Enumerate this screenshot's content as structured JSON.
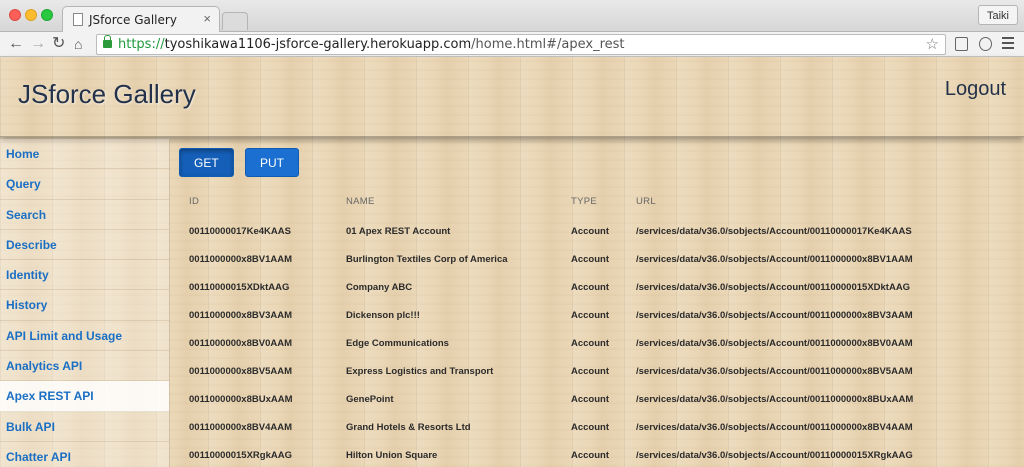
{
  "browser": {
    "tab_title": "JSforce Gallery",
    "tab_close": "×",
    "profile": "Taiki",
    "url_scheme": "https://",
    "url_host": "tyoshikawa1106-jsforce-gallery.herokuapp.com",
    "url_path": "/home.html#/apex_rest"
  },
  "header": {
    "title": "JSforce Gallery",
    "logout": "Logout"
  },
  "sidebar": {
    "items": [
      {
        "label": "Home"
      },
      {
        "label": "Query"
      },
      {
        "label": "Search"
      },
      {
        "label": "Describe"
      },
      {
        "label": "Identity"
      },
      {
        "label": "History"
      },
      {
        "label": "API Limit and Usage"
      },
      {
        "label": "Analytics API"
      },
      {
        "label": "Apex REST API",
        "active": true
      },
      {
        "label": "Bulk API"
      },
      {
        "label": "Chatter API"
      }
    ]
  },
  "toolbar": {
    "get_label": "GET",
    "put_label": "PUT"
  },
  "table": {
    "columns": [
      "ID",
      "NAME",
      "TYPE",
      "URL"
    ],
    "rows": [
      [
        "00110000017Ke4KAAS",
        "01 Apex REST Account",
        "Account",
        "/services/data/v36.0/sobjects/Account/00110000017Ke4KAAS"
      ],
      [
        "0011000000x8BV1AAM",
        "Burlington Textiles Corp of America",
        "Account",
        "/services/data/v36.0/sobjects/Account/0011000000x8BV1AAM"
      ],
      [
        "00110000015XDktAAG",
        "Company ABC",
        "Account",
        "/services/data/v36.0/sobjects/Account/00110000015XDktAAG"
      ],
      [
        "0011000000x8BV3AAM",
        "Dickenson plc!!!",
        "Account",
        "/services/data/v36.0/sobjects/Account/0011000000x8BV3AAM"
      ],
      [
        "0011000000x8BV0AAM",
        "Edge Communications",
        "Account",
        "/services/data/v36.0/sobjects/Account/0011000000x8BV0AAM"
      ],
      [
        "0011000000x8BV5AAM",
        "Express Logistics and Transport",
        "Account",
        "/services/data/v36.0/sobjects/Account/0011000000x8BV5AAM"
      ],
      [
        "0011000000x8BUxAAM",
        "GenePoint",
        "Account",
        "/services/data/v36.0/sobjects/Account/0011000000x8BUxAAM"
      ],
      [
        "0011000000x8BV4AAM",
        "Grand Hotels & Resorts Ltd",
        "Account",
        "/services/data/v36.0/sobjects/Account/0011000000x8BV4AAM"
      ],
      [
        "00110000015XRgkAAG",
        "Hilton Union Square",
        "Account",
        "/services/data/v36.0/sobjects/Account/00110000015XRgkAAG"
      ]
    ]
  }
}
